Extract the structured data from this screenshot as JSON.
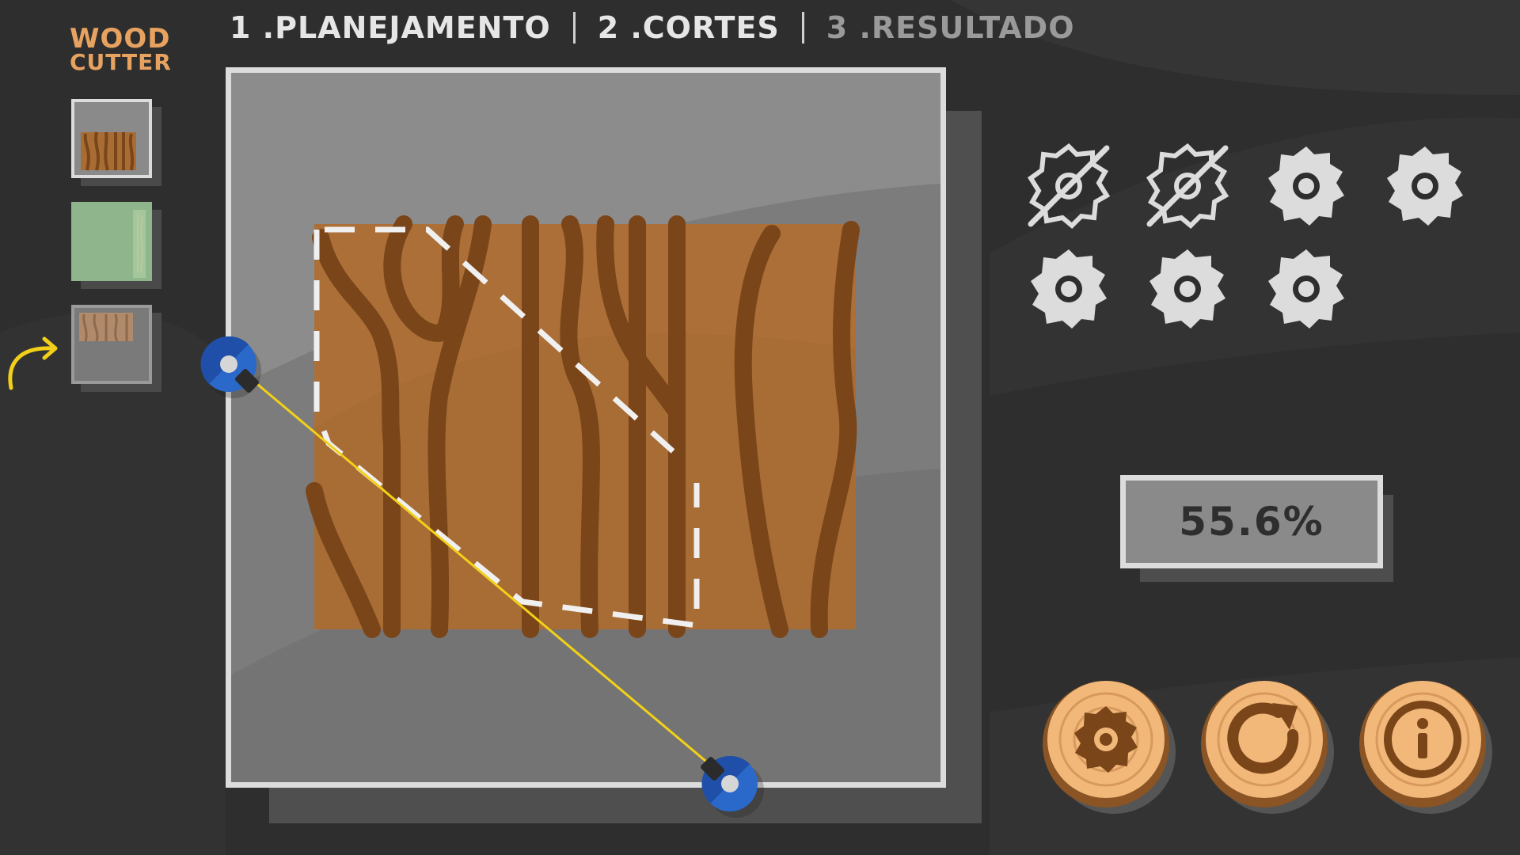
{
  "logo": {
    "line1": "WOOD",
    "line2": "CUTTER"
  },
  "steps": [
    {
      "label": "1 .PLANEJAMENTO",
      "state": "active"
    },
    {
      "label": "2 .CORTES",
      "state": "active"
    },
    {
      "label": "3 .RESULTADO",
      "state": "inactive"
    }
  ],
  "piece_thumbnails": [
    {
      "name": "wood-piece-dark",
      "selected": true
    },
    {
      "name": "wood-piece-green",
      "selected": false
    },
    {
      "name": "wood-piece-light",
      "selected": false,
      "pointer": "current"
    }
  ],
  "saws": [
    {
      "icon": "saw-blade-used-icon",
      "state": "used"
    },
    {
      "icon": "saw-blade-used-icon",
      "state": "used"
    },
    {
      "icon": "saw-blade-icon",
      "state": "available"
    },
    {
      "icon": "saw-blade-icon",
      "state": "available"
    },
    {
      "icon": "saw-blade-icon",
      "state": "available"
    },
    {
      "icon": "saw-blade-icon",
      "state": "available"
    },
    {
      "icon": "saw-blade-icon",
      "state": "available"
    }
  ],
  "score": {
    "percent": "55.6%"
  },
  "controls": [
    {
      "name": "cut-button",
      "icon": "saw-blade-icon"
    },
    {
      "name": "reset-button",
      "icon": "refresh-icon"
    },
    {
      "name": "info-button",
      "icon": "info-icon"
    }
  ],
  "colors": {
    "background": "#2e2e2e",
    "wood": "#a86c35",
    "wood_grain": "#7a4518",
    "laser": "#f2d019",
    "cutter_blue": "#2a68c9",
    "logo": "#e8a260",
    "saw": "#dcdcdc"
  }
}
